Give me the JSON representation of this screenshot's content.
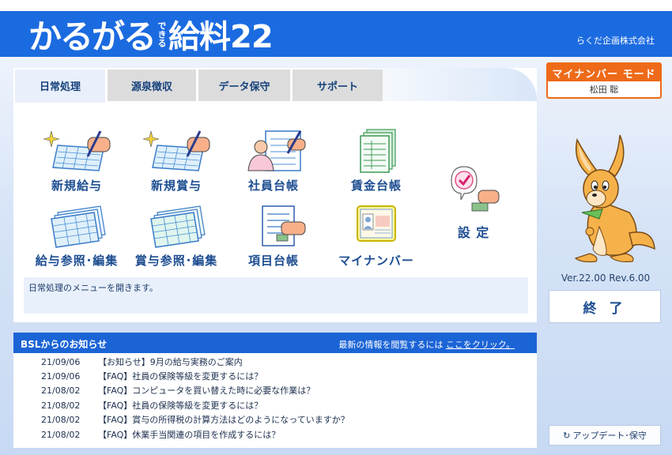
{
  "header": {
    "logo_main": "かるがる",
    "logo_sub": "できる",
    "logo_product": "給料22",
    "company": "らくだ企画株式会社"
  },
  "tabs": [
    {
      "label": "日常処理",
      "active": true
    },
    {
      "label": "源泉徴収",
      "active": false
    },
    {
      "label": "データ保守",
      "active": false
    },
    {
      "label": "サポート",
      "active": false
    }
  ],
  "menu": {
    "items": [
      {
        "label": "新規給与",
        "icon": "pen-sheet-sparkle-icon"
      },
      {
        "label": "新規賞与",
        "icon": "pen-sheet-sparkle-icon"
      },
      {
        "label": "社員台帳",
        "icon": "person-sheet-icon"
      },
      {
        "label": "賃金台帳",
        "icon": "ledger-stack-icon"
      },
      {
        "label": "給与参照･編集",
        "icon": "sheet-stack-icon"
      },
      {
        "label": "賞与参照･編集",
        "icon": "sheet-stack-icon"
      },
      {
        "label": "項目台帳",
        "icon": "hand-stamp-sheet-icon"
      },
      {
        "label": "マイナンバー",
        "icon": "id-card-icon"
      }
    ],
    "settings_label": "設 定",
    "description": "日常処理のメニューを開きます。"
  },
  "news": {
    "title": "BSLからのお知らせ",
    "link_prefix": "最新の情報を閲覧するには",
    "link_text": "ここをクリック。",
    "items": [
      {
        "date": "21/09/06",
        "text": "【お知らせ】9月の給与実務のご案内"
      },
      {
        "date": "21/09/06",
        "text": "【FAQ】社員の保険等級を変更するには？"
      },
      {
        "date": "21/08/02",
        "text": "【FAQ】コンピュータを買い替えた時に必要な作業は？"
      },
      {
        "date": "21/08/02",
        "text": "【FAQ】社員の保険等級を変更するには？"
      },
      {
        "date": "21/08/02",
        "text": "【FAQ】賞与の所得税の計算方法はどのようになっていますか？"
      },
      {
        "date": "21/08/02",
        "text": "【FAQ】休業手当関連の項目を作成するには？"
      }
    ]
  },
  "sidebar": {
    "mynumber_mode": "マイナンバー モード",
    "user": "松田 聡",
    "version": "Ver.22.00 Rev.6.00",
    "exit_label": "終 了",
    "update_label": "アップデート･保守"
  },
  "colors": {
    "brand_blue": "#1b6be0",
    "accent_orange": "#ee6a19",
    "label_blue": "#1d4d91"
  }
}
